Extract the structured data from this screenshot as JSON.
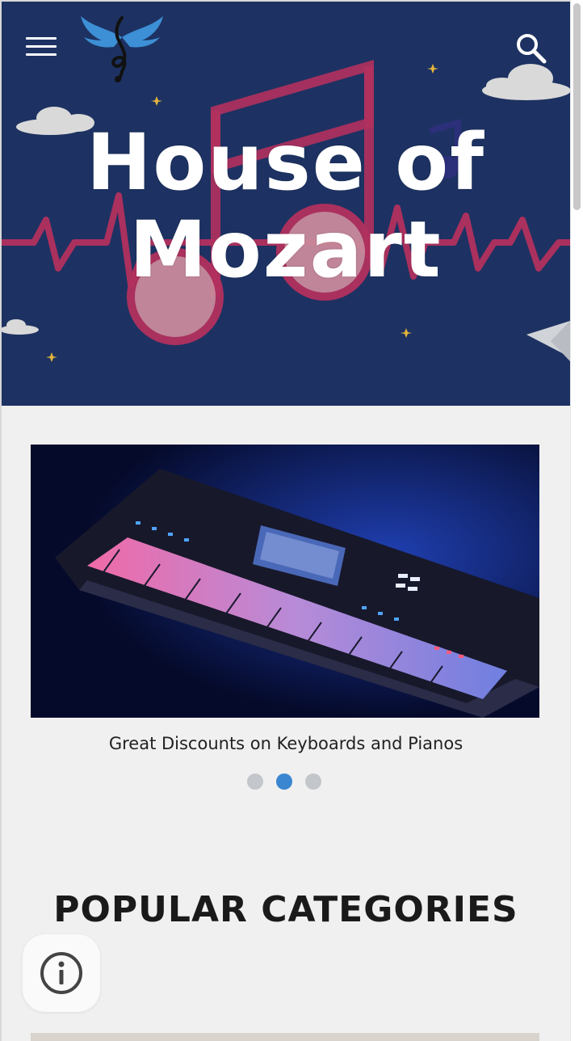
{
  "header": {
    "title": "House of Mozart",
    "title_line1": "House of",
    "title_line2": "Mozart",
    "menu_icon": "hamburger-menu-icon",
    "logo_icon": "winged-treble-clef-logo",
    "search_icon": "search-icon"
  },
  "carousel": {
    "caption": "Great Discounts on Keyboards and Pianos",
    "slide_count": 3,
    "active_index": 1
  },
  "sections": {
    "popular_title": "POPULAR CATEGORIES"
  },
  "info": {
    "icon": "info-icon"
  },
  "colors": {
    "hero_bg": "#1d3262",
    "hero_accent": "#b2305e",
    "dot_active": "#3a86d0",
    "dot_inactive": "#c3c6cb",
    "page_bg": "#f0f0f0"
  }
}
